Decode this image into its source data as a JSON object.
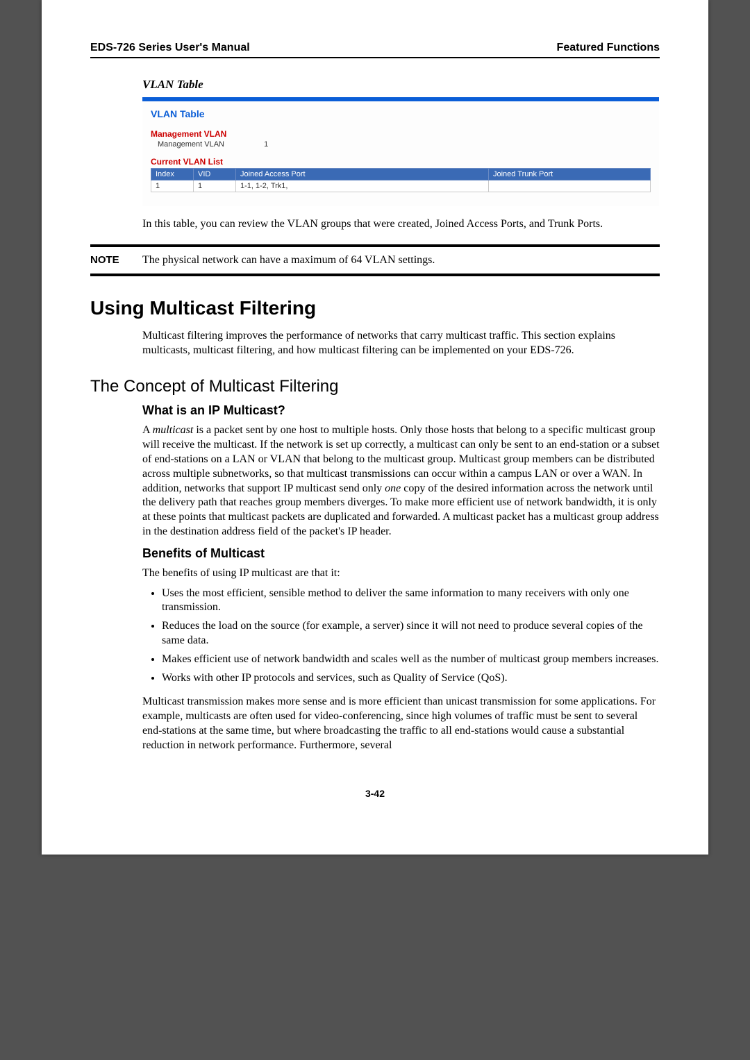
{
  "header": {
    "left": "EDS-726 Series User's Manual",
    "right": "Featured Functions"
  },
  "vlan": {
    "title_italic": "VLAN Table",
    "panel_title": "VLAN Table",
    "mgmt_head": "Management VLAN",
    "mgmt_label": "Management VLAN",
    "mgmt_value": "1",
    "list_head": "Current VLAN List",
    "cols": {
      "c1": "Index",
      "c2": "VID",
      "c3": "Joined Access Port",
      "c4": "Joined Trunk Port"
    },
    "row": {
      "index": "1",
      "vid": "1",
      "access": "1-1, 1-2, Trk1,",
      "trunk": ""
    }
  },
  "para_after_panel": "In this table, you can review the VLAN groups that were created, Joined Access Ports, and Trunk Ports.",
  "note": {
    "label": "NOTE",
    "text": "The physical network can have a maximum of 64 VLAN settings."
  },
  "h1": "Using Multicast Filtering",
  "h1_para": "Multicast filtering improves the performance of networks that carry multicast traffic. This section explains multicasts, multicast filtering, and how multicast filtering can be implemented on your EDS-726.",
  "h2": "The Concept of Multicast Filtering",
  "h3a": "What is an IP Multicast?",
  "h3a_para_pre": "A ",
  "h3a_para_em": "multicast",
  "h3a_para_mid": " is a packet sent by one host to multiple hosts. Only those hosts that belong to a specific multicast group will receive the multicast. If the network is set up correctly, a multicast can only be sent to an end-station or a subset of end-stations on a LAN or VLAN that belong to the multicast group. Multicast group members can be distributed across multiple subnetworks, so that multicast transmissions can occur within a campus LAN or over a WAN. In addition, networks that support IP multicast send only ",
  "h3a_para_em2": "one",
  "h3a_para_post": " copy of the desired information across the network until the delivery path that reaches group members diverges. To make more efficient use of network bandwidth, it is only at these points that multicast packets are duplicated and forwarded. A multicast packet has a multicast group address in the destination address field of the packet's IP header.",
  "h3b": "Benefits of Multicast",
  "h3b_intro": "The benefits of using IP multicast are that it:",
  "bullets": [
    "Uses the most efficient, sensible method to deliver the same information to many receivers with only one transmission.",
    "Reduces the load on the source (for example, a server) since it will not need to produce several copies of the same data.",
    "Makes efficient use of network bandwidth and scales well as the number of multicast group members increases.",
    "Works with other IP protocols and services, such as Quality of Service (QoS)."
  ],
  "closing_para": "Multicast transmission makes more sense and is more efficient than unicast transmission for some applications. For example, multicasts are often used for video-conferencing, since high volumes of traffic must be sent to several end-stations at the same time, but where broadcasting the traffic to all end-stations would cause a substantial reduction in network performance. Furthermore, several",
  "page_number": "3-42"
}
